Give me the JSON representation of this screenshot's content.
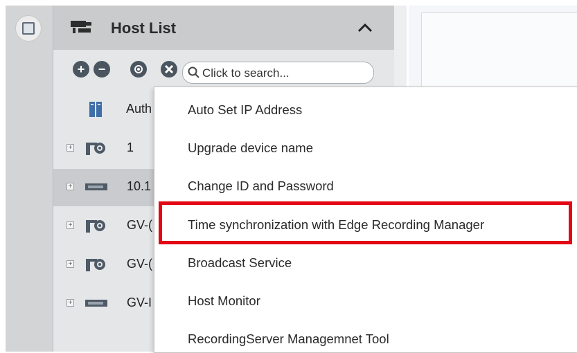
{
  "host_panel": {
    "title": "Host List",
    "search_placeholder": "Click to search..."
  },
  "toolbar": {
    "add_label": "+",
    "remove_label": "−"
  },
  "tree": [
    {
      "label": "Auth",
      "icon": "server-icon",
      "expander": ""
    },
    {
      "label": "1",
      "icon": "camera-icon",
      "expander": "+"
    },
    {
      "label": "10.1",
      "icon": "nvr-icon",
      "expander": "+",
      "selected": true
    },
    {
      "label": "GV-(",
      "icon": "camera-icon",
      "expander": "+"
    },
    {
      "label": "GV-(",
      "icon": "camera-icon",
      "expander": "+"
    },
    {
      "label": "GV-I",
      "icon": "nvr-icon",
      "expander": "+"
    }
  ],
  "context_menu": [
    "Auto Set IP Address",
    "Upgrade device name",
    "Change ID and Password",
    "Time synchronization with Edge Recording Manager",
    "Broadcast Service",
    "Host Monitor",
    "RecordingServer Managemnet Tool"
  ],
  "highlight_color": "#e30613"
}
